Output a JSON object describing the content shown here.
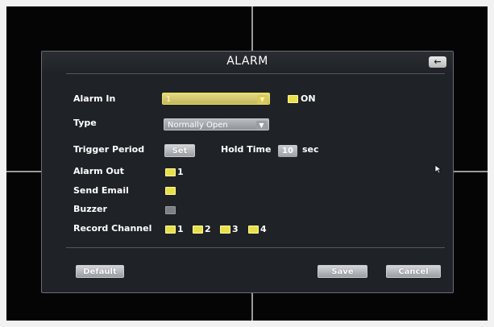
{
  "dialog": {
    "title": "ALARM",
    "back_icon": "arrow-left-icon"
  },
  "alarm_in": {
    "label": "Alarm In",
    "value": "1",
    "on_label": "ON"
  },
  "type": {
    "label": "Type",
    "value": "Normally Open"
  },
  "trigger_period": {
    "label": "Trigger Period",
    "set_label": "Set",
    "hold_time_label": "Hold Time",
    "hold_time_value": "10",
    "unit": "sec"
  },
  "alarm_out": {
    "label": "Alarm Out",
    "channel": "1"
  },
  "send_email": {
    "label": "Send Email"
  },
  "buzzer": {
    "label": "Buzzer"
  },
  "record_channel": {
    "label": "Record Channel",
    "channels": [
      "1",
      "2",
      "3",
      "4"
    ]
  },
  "footer": {
    "default_label": "Default",
    "save_label": "Save",
    "cancel_label": "Cancel"
  },
  "colors": {
    "checkbox_on": "#e8e04a",
    "checkbox_off": "#7d8086",
    "dialog_bg": "#1f2226"
  }
}
